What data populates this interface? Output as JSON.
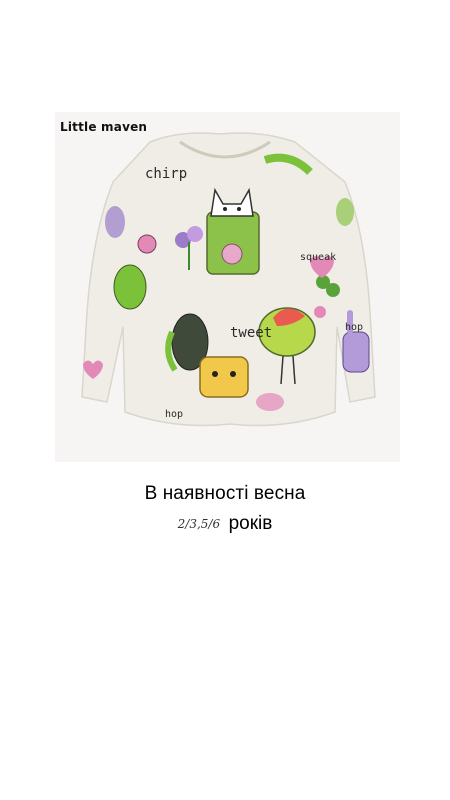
{
  "image": {
    "brand_label": "Little maven",
    "print_words": [
      "chirp",
      "tweet",
      "squeak",
      "hop",
      "hop"
    ]
  },
  "caption": {
    "line1": "В наявності весна",
    "sizes": "2/3,5/6",
    "years": "років"
  },
  "colors": {
    "background": "#ffffff",
    "shirt": "#efede6",
    "green": "#7bc23a",
    "pink": "#e389b8",
    "purple": "#9a7cc8",
    "yellow": "#f2c84b"
  }
}
